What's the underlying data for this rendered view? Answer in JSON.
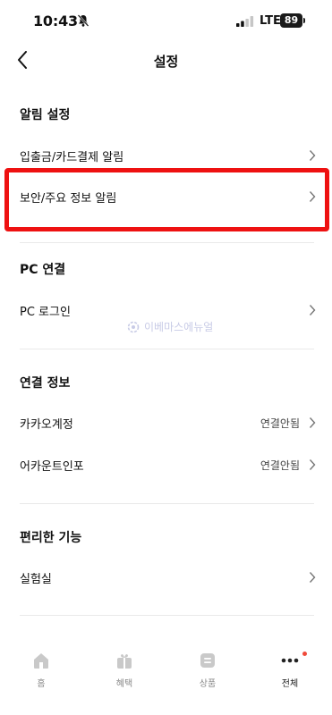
{
  "status_bar": {
    "time": "10:43",
    "network": "LTE",
    "battery": "89"
  },
  "header": {
    "title": "설정"
  },
  "sections": [
    {
      "title": "알림 설정",
      "items": [
        {
          "label": "입출금/카드결제 알림"
        },
        {
          "label": "보안/주요 정보 알림"
        }
      ]
    },
    {
      "title": "PC 연결",
      "items": [
        {
          "label": "PC 로그인"
        }
      ]
    },
    {
      "title": "연결 정보",
      "items": [
        {
          "label": "카카오계정",
          "value": "연결안됨"
        },
        {
          "label": "어카운트인포",
          "value": "연결안됨"
        }
      ]
    },
    {
      "title": "편리한 기능",
      "items": [
        {
          "label": "실험실"
        }
      ]
    }
  ],
  "watermark": "이베마스에뉴얼",
  "highlight_color": "#ee1111",
  "bottom_nav": [
    {
      "label": "홈",
      "icon": "home-icon"
    },
    {
      "label": "혜택",
      "icon": "gift-icon"
    },
    {
      "label": "상품",
      "icon": "product-icon"
    },
    {
      "label": "전체",
      "icon": "more-icon"
    }
  ]
}
